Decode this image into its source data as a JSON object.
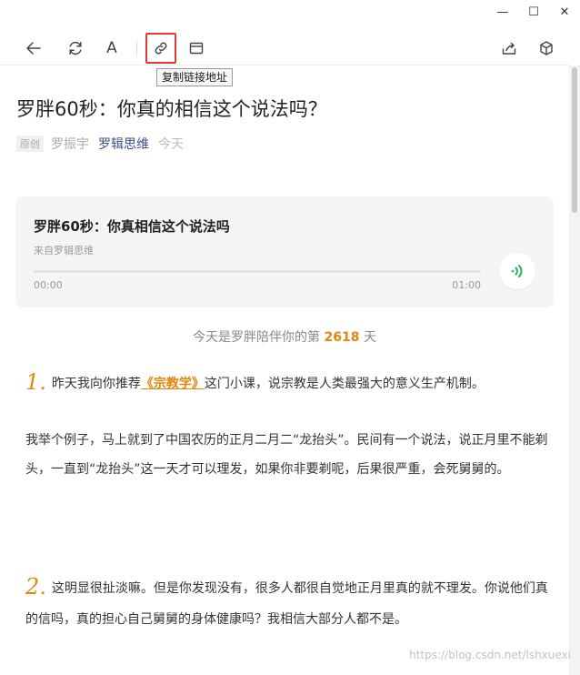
{
  "window": {
    "minimize_glyph": "—",
    "maximize_glyph": "☐",
    "close_glyph": "✕"
  },
  "toolbar": {
    "icons": [
      "back-icon",
      "refresh-icon",
      "font-icon",
      "link-icon",
      "window-icon",
      "share-icon",
      "cube-icon"
    ],
    "font_glyph": "A",
    "tooltip": "复制链接地址",
    "highlight_color": "#e53935"
  },
  "article": {
    "title": "罗胖60秒：你真的相信这个说法吗？",
    "tag": "原创",
    "author": "罗振宇",
    "source": "罗辑思维",
    "date": "今天"
  },
  "audio": {
    "title": "罗胖60秒：你真相信这个说法吗",
    "from": "来自罗辑思维",
    "time_start": "00:00",
    "time_end": "01:00",
    "progress_fraction": 0,
    "accent_color": "#2fb25c"
  },
  "days": {
    "prefix": "今天是罗胖陪伴你的第",
    "count": "2618",
    "suffix": "天"
  },
  "paragraphs": {
    "p1_num": "1.",
    "p1_before": "昨天我向你推荐",
    "p1_link": "《宗教学》",
    "p1_after": "这门小课，说宗教是人类最强大的意义生产机制。",
    "p2": "我举个例子，马上就到了中国农历的正月二月二“龙抬头”。民间有一个说法，说正月里不能剃头，一直到“龙抬头”这一天才可以理发，如果你非要剃呢，后果很严重，会死舅舅的。",
    "p3_num": "2.",
    "p3": "这明显很扯淡嘛。但是你发现没有，很多人都很自觉地正月里真的就不理发。你说他们真的信吗，真的担心自己舅舅的身体健康吗？我相信大部分人都不是。"
  },
  "watermark": "https://blog.csdn.net/lshxuexi"
}
